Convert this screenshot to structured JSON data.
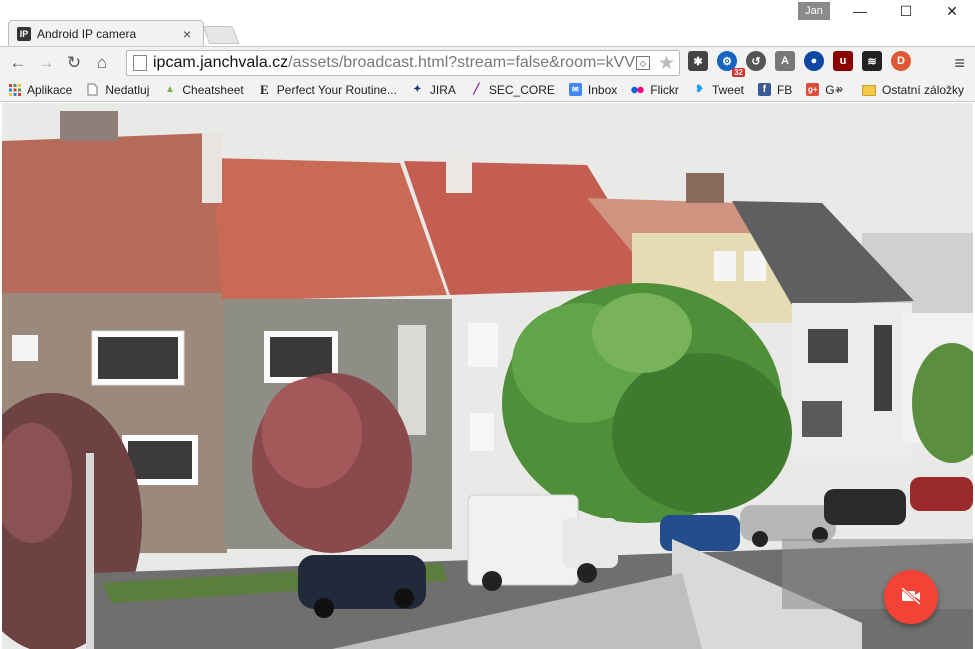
{
  "window": {
    "user_name": "Jan",
    "minimize_glyph": "—",
    "maximize_glyph": "☐",
    "close_glyph": "✕"
  },
  "tab": {
    "favicon_text": "IP",
    "title": "Android IP camera",
    "close_glyph": "×"
  },
  "toolbar": {
    "back_glyph": "←",
    "forward_glyph": "→",
    "reload_glyph": "↻",
    "home_glyph": "⌂",
    "url_host": "ipcam.janchvala.cz",
    "url_path": "/assets/broadcast.html?stream=false&room=kVVE",
    "star_glyph": "★",
    "menu_glyph": "≡",
    "extension_badge": "32",
    "extensions": [
      {
        "icon": "bug-icon",
        "color": "#444444"
      },
      {
        "icon": "gear-ext-icon",
        "color": "#1565c0"
      },
      {
        "icon": "sync-icon",
        "color": "#555555"
      },
      {
        "icon": "angular-icon",
        "color": "#777777"
      },
      {
        "icon": "orb-icon",
        "color": "#0d47a1"
      },
      {
        "icon": "ublock-icon",
        "color": "#8b0000"
      },
      {
        "icon": "layers-icon",
        "color": "#222222"
      },
      {
        "icon": "duckduckgo-icon",
        "color": "#de5833"
      }
    ]
  },
  "bookmarks": {
    "items": [
      {
        "label": "Aplikace",
        "icon": "apps-grid-icon",
        "color": "#e53935"
      },
      {
        "label": "Nedatluj",
        "icon": "page-icon",
        "color": "#777777"
      },
      {
        "label": "Cheatsheet",
        "icon": "android-icon",
        "color": "#7cb342"
      },
      {
        "label": "Perfect Your Routine...",
        "icon": "e-letter-icon",
        "color": "#222222"
      },
      {
        "label": "JIRA",
        "icon": "jira-icon",
        "color": "#1a3a7a"
      },
      {
        "label": "SEC_CORE",
        "icon": "feather-icon",
        "color": "#8e24aa"
      },
      {
        "label": "Inbox",
        "icon": "inbox-icon",
        "color": "#4285f4"
      },
      {
        "label": "Flickr",
        "icon": "flickr-icon",
        "color": "#ff0084"
      },
      {
        "label": "Tweet",
        "icon": "twitter-icon",
        "color": "#1da1f2"
      },
      {
        "label": "FB",
        "icon": "facebook-icon",
        "color": "#3b5998"
      },
      {
        "label": "G+",
        "icon": "google-plus-icon",
        "color": "#dd4b39"
      }
    ],
    "more_glyph": "»",
    "other_label": "Ostatní záložky"
  },
  "camera": {
    "stop_button_icon": "video-off-icon",
    "accent_color": "#f44336"
  }
}
